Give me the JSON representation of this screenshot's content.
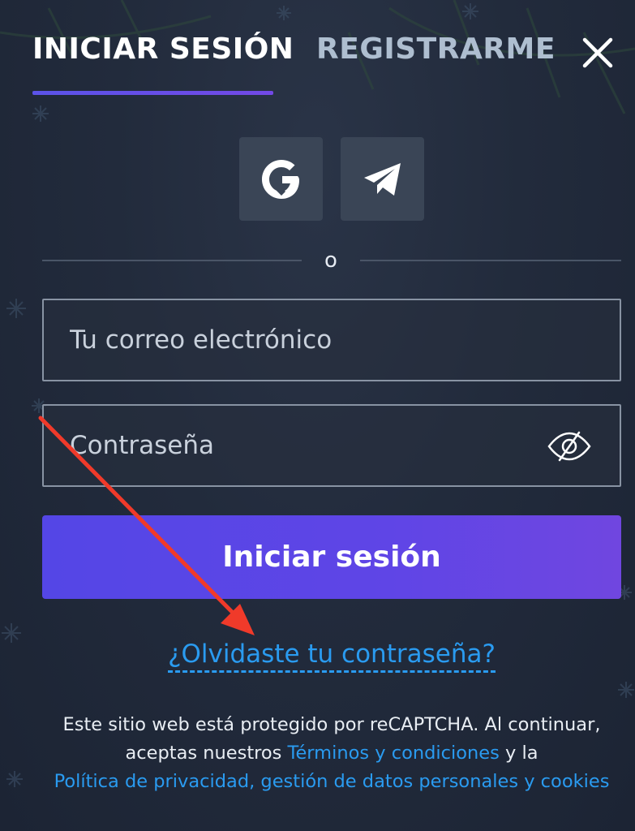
{
  "tabs": {
    "login_label": "INICIAR SESIÓN",
    "register_label": "REGISTRARME",
    "active": "login"
  },
  "social": {
    "google_icon": "google-icon",
    "telegram_icon": "telegram-icon"
  },
  "divider": {
    "text": "o"
  },
  "form": {
    "email_placeholder": "Tu correo electrónico",
    "email_value": "",
    "password_placeholder": "Contraseña",
    "password_value": "",
    "submit_label": "Iniciar sesión"
  },
  "forgot_password": "¿Olvidaste tu contraseña?",
  "legal": {
    "text_1": "Este sitio web está protegido por reCAPTCHA. Al continuar, aceptas nuestros ",
    "terms_link": "Términos y condiciones",
    "text_2": " y la ",
    "privacy_link": "Política de privacidad, gestión de datos personales y cookies"
  },
  "colors": {
    "background": "#222b3c",
    "accent": "#5b53e8",
    "link": "#2a9bf0",
    "annotation_arrow": "#f03a2a"
  }
}
